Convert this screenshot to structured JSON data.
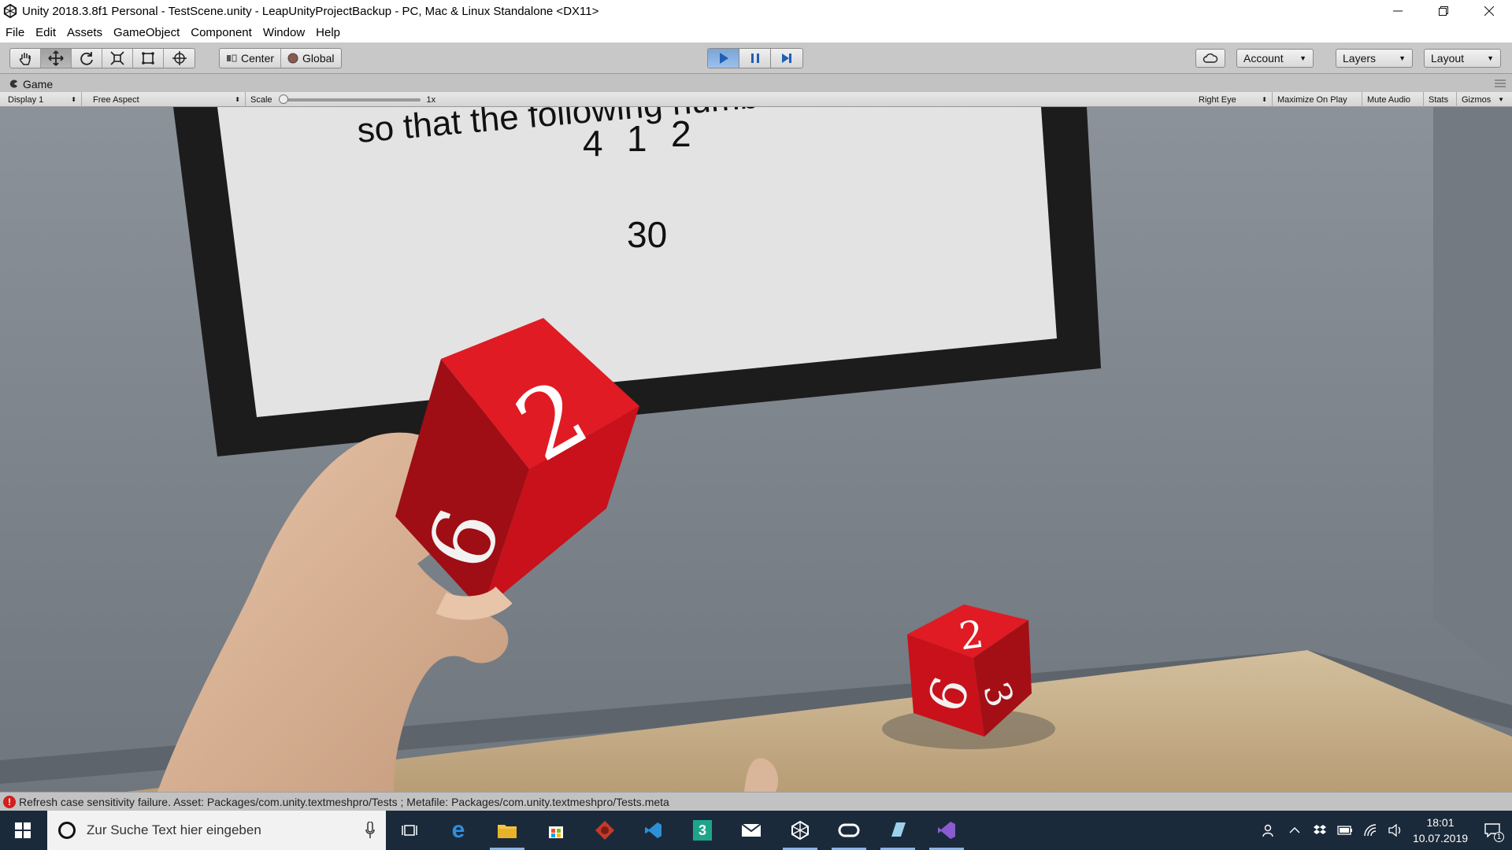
{
  "window": {
    "title": "Unity 2018.3.8f1 Personal - TestScene.unity - LeapUnityProjectBackup - PC, Mac & Linux Standalone <DX11>",
    "controls": [
      "minimize-icon",
      "restore-icon",
      "close-icon"
    ]
  },
  "menu": [
    "File",
    "Edit",
    "Assets",
    "GameObject",
    "Component",
    "Window",
    "Help"
  ],
  "toolbar": {
    "tools": [
      "hand-tool-icon",
      "move-tool-icon",
      "rotate-tool-icon",
      "scale-tool-icon",
      "rect-tool-icon",
      "transform-tool-icon"
    ],
    "pivot_label": "Center",
    "space_label": "Global",
    "playback": [
      "play-icon",
      "pause-icon",
      "step-icon"
    ],
    "account_label": "Account",
    "layers_label": "Layers",
    "layout_label": "Layout"
  },
  "game_view": {
    "tab_label": "Game",
    "display_label": "Display 1",
    "aspect_label": "Free Aspect",
    "scale_label": "Scale",
    "scale_value": "1x",
    "scale_fraction": 0.0,
    "eye_label": "Right Eye",
    "maximize_label": "Maximize On Play",
    "mute_label": "Mute Audio",
    "stats_label": "Stats",
    "gizmos_label": "Gizmos"
  },
  "scene": {
    "board_instruction": "so that the following numbers",
    "board_numbers": [
      "4",
      "1",
      "2"
    ],
    "board_target": "30",
    "die_large_faces": [
      "2",
      "6"
    ],
    "die_small_faces": [
      "2",
      "6",
      "3"
    ],
    "colors": {
      "die_red": "#c8111a",
      "board_frame": "#1c1c1c",
      "board_screen": "#e3e3e3",
      "wall": "#7f868e",
      "table": "#c9b28f"
    }
  },
  "status": {
    "message": "Refresh case sensitivity failure. Asset: Packages/com.unity.textmeshpro/Tests ; Metafile: Packages/com.unity.textmeshpro/Tests.meta",
    "error_color": "#d21e1e"
  },
  "taskbar": {
    "search_placeholder": "Zur Suche Text hier eingeben",
    "apps": [
      "task-view-icon",
      "edge-icon",
      "file-explorer-icon",
      "store-icon",
      "leap-motion-icon",
      "vs-code-icon",
      "app-3-icon",
      "mail-icon",
      "unity-icon",
      "oculus-icon",
      "notepad-icon",
      "visual-studio-icon"
    ],
    "time": "18:01",
    "date": "10.07.2019",
    "notification_count": "1"
  }
}
